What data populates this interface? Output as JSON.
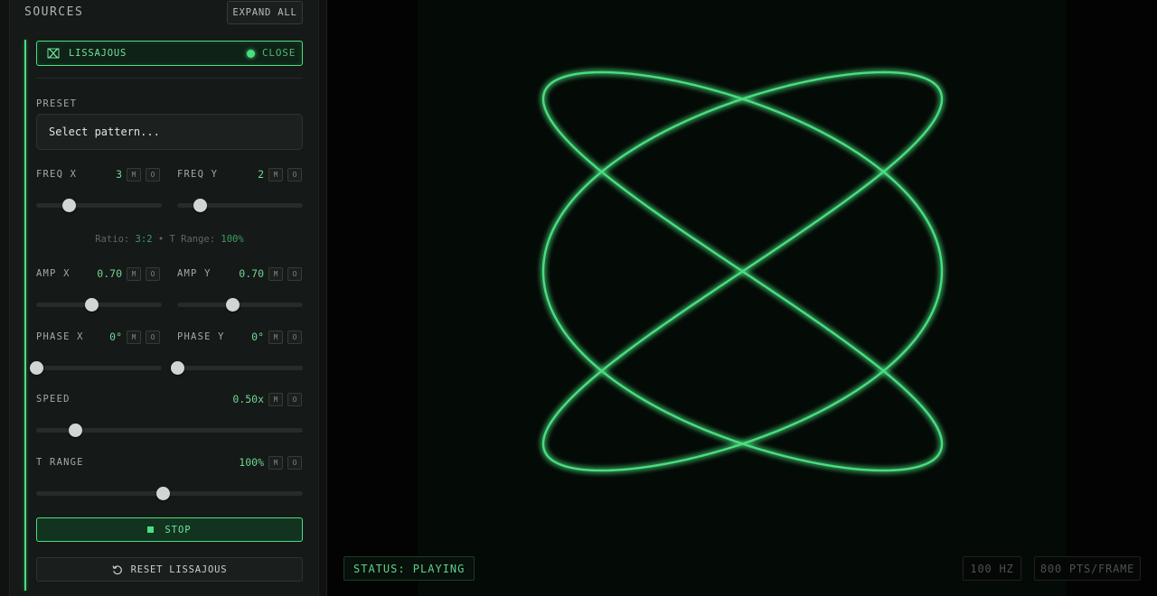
{
  "sidebar": {
    "title": "SOURCES",
    "expand_label": "EXPAND ALL"
  },
  "source": {
    "name": "LISSAJOUS",
    "close_label": "CLOSE",
    "preset": {
      "label": "PRESET",
      "value": "Select pattern..."
    },
    "freq_x": {
      "label": "FREQ X",
      "value": "3",
      "level": 0.26
    },
    "freq_y": {
      "label": "FREQ Y",
      "value": "2",
      "level": 0.18
    },
    "ratio_info": {
      "ratio_label": "Ratio:",
      "ratio_value": "3:2",
      "sep": "•",
      "t_range_label": "T Range:",
      "t_range_value": "100%"
    },
    "amp_x": {
      "label": "AMP X",
      "value": "0.70",
      "level": 0.44
    },
    "amp_y": {
      "label": "AMP Y",
      "value": "0.70",
      "level": 0.44
    },
    "phase_x": {
      "label": "PHASE X",
      "value": "0°",
      "level": 0.0
    },
    "phase_y": {
      "label": "PHASE Y",
      "value": "0°",
      "level": 0.0
    },
    "speed": {
      "label": "SPEED",
      "value": "0.50x",
      "level": 0.145
    },
    "t_range": {
      "label": "T RANGE",
      "value": "100%",
      "level": 0.475
    },
    "mute_label": "M",
    "solo_label": "O",
    "stop_label": "STOP",
    "reset_label": "RESET LISSAJOUS"
  },
  "scope": {
    "status_text": "STATUS: PLAYING",
    "rate_text": "100 HZ",
    "points_text": "800 PTS/FRAME",
    "trace_color": "#4ade80"
  },
  "colors": {
    "accent": "#4ade80",
    "panel_bg": "#151917",
    "scope_bg": "#040a05"
  }
}
